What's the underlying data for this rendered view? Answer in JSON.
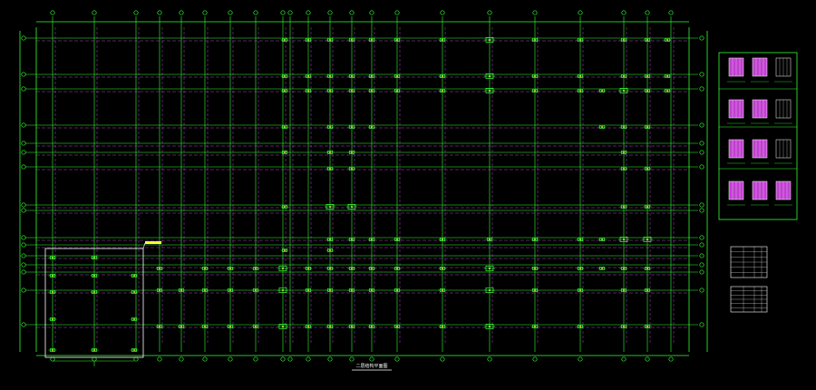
{
  "drawing": {
    "title": "二层结构平面图",
    "colors": {
      "background": "#000000",
      "axis": "#33ff33",
      "grid": "#b044c8",
      "column": "#33ff33",
      "highlight": "#ffff33",
      "frame": "#ffffff",
      "detail_fill": "#c040d0"
    },
    "icons": [
      "grid-bubble-icon",
      "column-node-icon"
    ]
  }
}
